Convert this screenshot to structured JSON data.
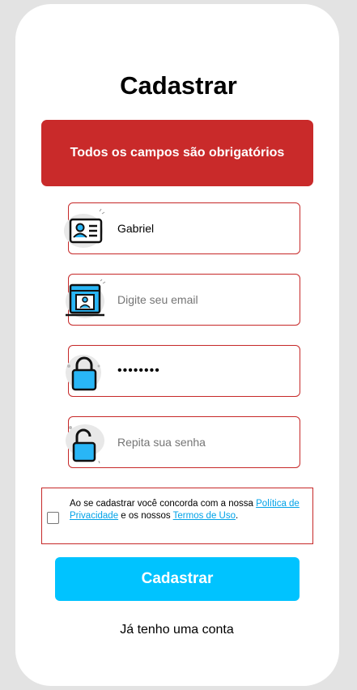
{
  "form": {
    "title": "Cadastrar",
    "error_message": "Todos os campos são obrigatórios",
    "fields": [
      {
        "name": "name",
        "value": "Gabriel",
        "placeholder": "",
        "icon": "id-card-icon"
      },
      {
        "name": "email",
        "value": "",
        "placeholder": "Digite seu email",
        "icon": "computer-user-icon"
      },
      {
        "name": "password",
        "value": "12345678",
        "placeholder": "",
        "icon": "lock-closed-icon"
      },
      {
        "name": "confirm_password",
        "value": "",
        "placeholder": "Repita sua senha",
        "icon": "lock-open-icon"
      }
    ],
    "terms": {
      "text_before": "Ao se cadastrar você concorda com a nossa ",
      "privacy_link": "Política de Privacidade",
      "text_middle": " e os nossos ",
      "terms_link": "Termos de Uso",
      "text_after": ".",
      "checked": false
    },
    "submit_label": "Cadastrar",
    "login_link": "Já tenho uma conta"
  },
  "colors": {
    "error_bg": "#c92a2a",
    "accent": "#00c3ff",
    "icon_fill": "#29b6f6",
    "field_border": "#c62828",
    "link": "#00a2e8"
  }
}
